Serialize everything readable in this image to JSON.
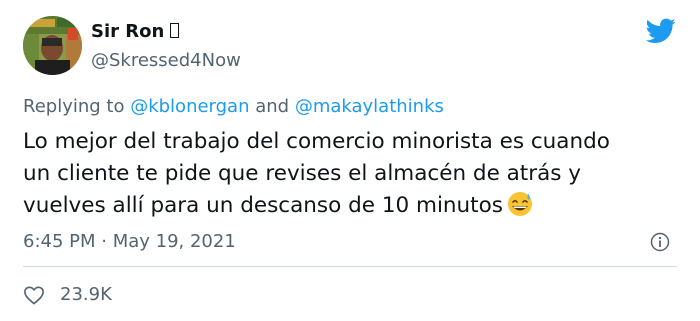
{
  "author": {
    "display_name": "Sir Ron",
    "handle": "@Skressed4Now"
  },
  "reply": {
    "prefix": "Replying to ",
    "mention_1": "@kblonergan",
    "conjunction": " and ",
    "mention_2": "@makaylathinks"
  },
  "tweet": {
    "lines": [
      "Lo mejor del trabajo del comercio minorista es cuando",
      "un cliente te pide que revises el almacén de atrás y",
      "vuelves allí para un descanso de 10 minutos"
    ],
    "emoji": "grinning-face-with-sweat",
    "timestamp": "6:45 PM · May 19, 2021"
  },
  "stats": {
    "likes": "23.9K"
  },
  "colors": {
    "text": "#0f1419",
    "secondary": "#536471",
    "mention": "#1d9bf0",
    "twitter_blue": "#1d9bf0",
    "divider": "#cfd9de"
  },
  "icons": {
    "logo": "twitter-bird-icon",
    "info": "info-icon",
    "like": "heart-icon"
  }
}
